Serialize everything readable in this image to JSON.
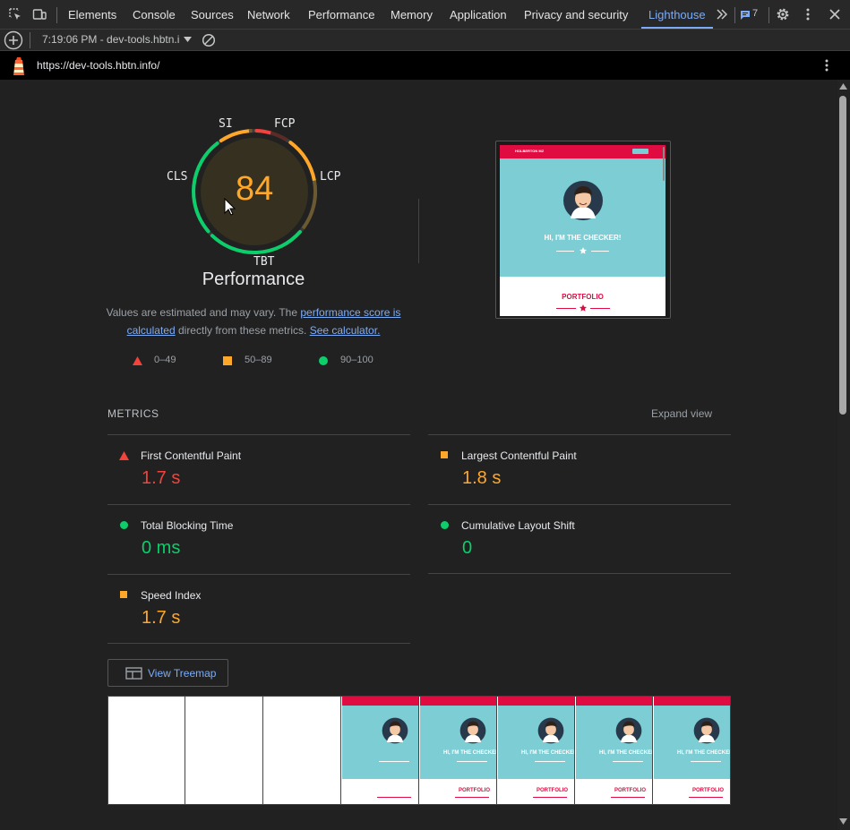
{
  "devtools": {
    "tabs": [
      "Elements",
      "Console",
      "Sources",
      "Network",
      "Performance",
      "Memory",
      "Application",
      "Privacy and security",
      "Lighthouse"
    ],
    "issues_count": "7",
    "report_selector": "7:19:06 PM - dev-tools.hbtn.i",
    "url": "https://dev-tools.hbtn.info/"
  },
  "gauge": {
    "score": "84",
    "label": "Performance",
    "labels": {
      "si": "SI",
      "fcp": "FCP",
      "lcp": "LCP",
      "tbt": "TBT",
      "cls": "CLS"
    }
  },
  "note": {
    "prefix": "Values are estimated and may vary. The ",
    "link1_a": "performance score is",
    "link1_b": "calculated",
    "middle": " directly from these metrics. ",
    "link2": "See calculator."
  },
  "legend": {
    "fail": "0–49",
    "average": "50–89",
    "pass": "90–100"
  },
  "metrics_section": {
    "heading": "METRICS",
    "expand": "Expand view",
    "items": [
      {
        "title": "First Contentful Paint",
        "value": "1.7 s",
        "rating": "fail"
      },
      {
        "title": "Largest Contentful Paint",
        "value": "1.8 s",
        "rating": "average"
      },
      {
        "title": "Total Blocking Time",
        "value": "0 ms",
        "rating": "pass"
      },
      {
        "title": "Cumulative Layout Shift",
        "value": "0",
        "rating": "pass"
      },
      {
        "title": "Speed Index",
        "value": "1.7 s",
        "rating": "average"
      }
    ]
  },
  "treemap_button": "View Treemap",
  "screenshot": {
    "brand": "HOLBERTON MZ",
    "hero": "HI, I'M THE CHECKER!",
    "section": "PORTFOLIO"
  },
  "colors": {
    "fail": "#f4423c",
    "average": "#ffa729",
    "pass": "#0cce6a",
    "accent": "#7cacf8",
    "brand": "#e00c41",
    "teal": "#7ccdd4"
  }
}
